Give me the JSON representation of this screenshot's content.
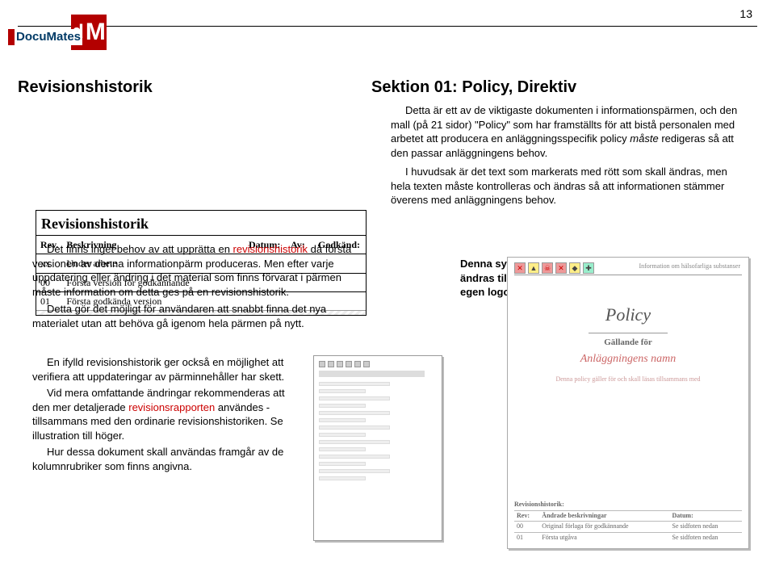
{
  "page_number": "13",
  "logo": {
    "text": "DocuMates",
    "square": "dM"
  },
  "heading_left": "Revisionshistorik",
  "heading_right": "Sektion 01: Policy, Direktiv",
  "revtable": {
    "title": "Revisionshistorik",
    "headers": [
      "Rev.",
      "Beskrivning",
      "Datum:",
      "Av:",
      "Godkänd:"
    ],
    "rows": [
      [
        "xx",
        "Under arbete",
        "",
        "",
        ""
      ],
      [
        "00",
        "Första version för godkännande",
        "",
        "",
        ""
      ],
      [
        "01",
        "Första godkända version",
        "",
        "",
        ""
      ]
    ]
  },
  "right_col": {
    "p1a": "Detta är ett av de viktigaste dokumenten i informationspärmen, och den mall (på 21 sidor) \"Policy\" som har framställts för att bistå personalen med arbetet att producera en anläggningsspecifik policy ",
    "p1b": "måste",
    "p1c": " redigeras så att den passar anläggningens behov.",
    "p2": "I huvudsak är det text som markerats med rött som skall ändras, men hela texten måste kontrolleras och ändras så att informationen stämmer överens med anläggningens behov."
  },
  "lower_left": {
    "p1a": "Det finns inget behov av att upprätta en ",
    "p1b": "revisionshistorik",
    "p1c": " då första versionen av denna informationpärm produceras. Men efter varje uppdatering eller ändring i det material som finns förvarat i pärmen måste information om detta ges på en revisionshistorik.",
    "p2": "Detta gör det möjligt för användaren att snabbt finna det nya materialet utan att behöva gå igenom hela pärmen på nytt.",
    "p3": "En ifylld revisionshistorik ger också en möjlighet att verifiera att uppdateringar av pärminnehåller har skett.",
    "p4a": "Vid mera omfattande ändringar rekommenderas att den mer detaljerade ",
    "p4b": "revisionsrapporten",
    "p4c": " användes - tillsammans med den ordinarie revisionshistoriken. Se illustration till höger.",
    "p5": "Hur dessa dokument skall användas framgår av de kolumnrubriker som finns angivna."
  },
  "symbol_note": "Denna symbol bör ändras till företagets egen logotyp",
  "policy_page": {
    "info_right": "Information om hälsofarliga substanser",
    "title": "Policy",
    "sub1": "Gällande för",
    "sub2": "Anläggningens namn",
    "sub3": "Denna policy gäller för och skall läsas tillsammans med",
    "rev_caption": "Revisionshistorik:",
    "rev_headers": [
      "Rev:",
      "Ändrade beskrivningar",
      "Datum:"
    ],
    "rev_rows": [
      [
        "00",
        "Original förlaga för godkännande",
        "Se sidfoten nedan"
      ],
      [
        "01",
        "Första utgåva",
        "Se sidfoten nedan"
      ]
    ]
  }
}
